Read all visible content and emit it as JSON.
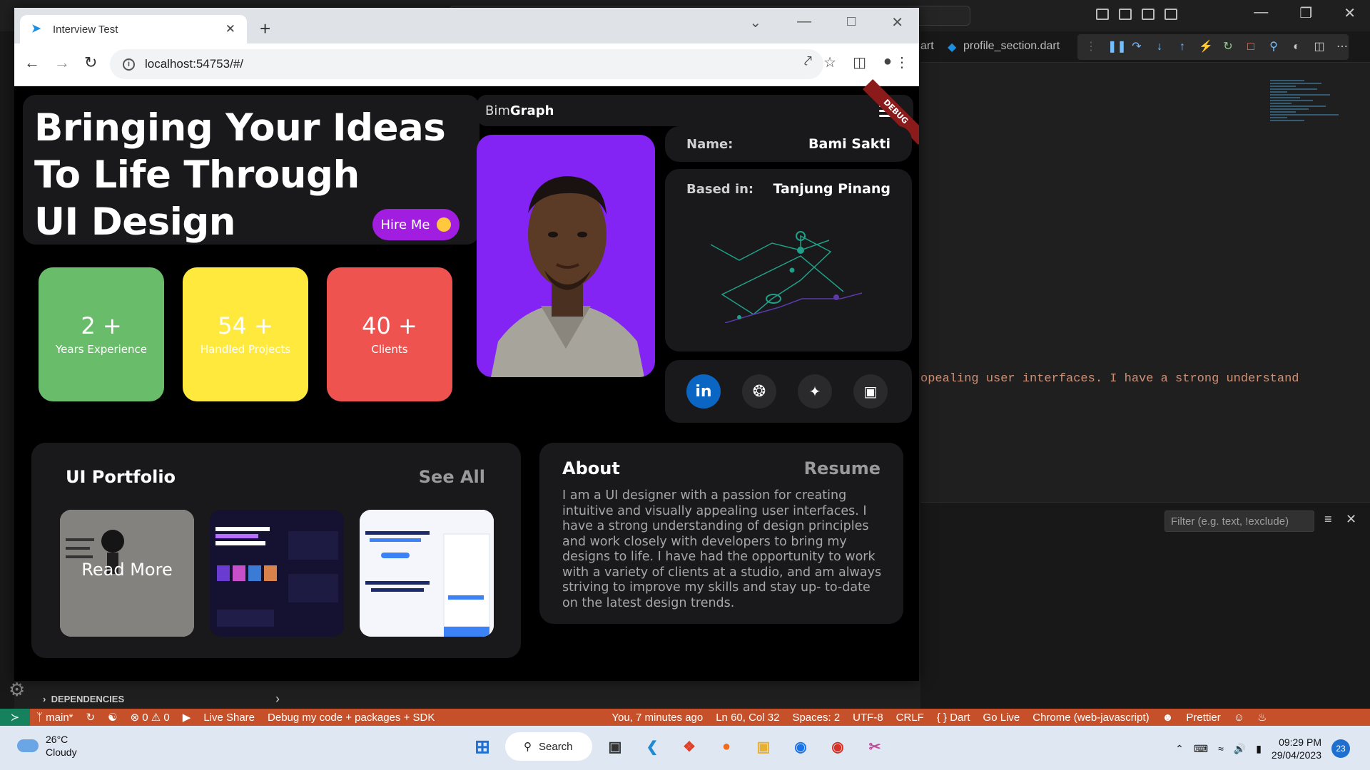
{
  "vscode": {
    "tabs": [
      "art",
      "profile_section.dart"
    ],
    "editor_snippet": "opealing user interfaces. I have a strong understand",
    "filter_placeholder": "Filter (e.g. text, !exclude)",
    "sidebar_section": "DEPENDENCIES",
    "status": {
      "branch": "main*",
      "problems": "⊗ 0 ⚠ 0",
      "live_share": "Live Share",
      "debug_config": "Debug my code + packages + SDK",
      "blame": "You, 7 minutes ago",
      "position": "Ln 60, Col 32",
      "spaces": "Spaces: 2",
      "encoding": "UTF-8",
      "eol": "CRLF",
      "language": "{ } Dart",
      "go_live": "Go Live",
      "device": "Chrome (web-javascript)",
      "prettier": "Prettier"
    }
  },
  "browser": {
    "tab_title": "Interview Test",
    "url": "localhost:54753/#/"
  },
  "app": {
    "hero_line1": "Bringing Your Ideas",
    "hero_line2": "To Life Through",
    "hero_line3": "UI Design",
    "hire_label": "Hire Me",
    "brand_light": "Bim",
    "brand_bold": "Graph",
    "debug_banner": "DEBUG",
    "stats": [
      {
        "value": "2 +",
        "label": "Years Experience",
        "color": "#69bd6a"
      },
      {
        "value": "54 +",
        "label": "Handled Projects",
        "color": "#ffe93d"
      },
      {
        "value": "40 +",
        "label": "Clients",
        "color": "#ef5350"
      }
    ],
    "name_key": "Name:",
    "name_value": "Bami Sakti",
    "based_key": "Based in:",
    "based_value": "Tanjung Pinang",
    "social": [
      "linkedin-icon",
      "dribbble-icon",
      "twitter-icon",
      "instagram-icon"
    ],
    "portfolio_title": "UI Portfolio",
    "see_all": "See All",
    "read_more": "Read More",
    "about_title": "About",
    "resume_label": "Resume",
    "about_text": "I am a UI designer with a passion for creating intuitive and visually appealing user interfaces. I have a strong understanding of design principles and work closely with developers to bring my designs to life. I have had the opportunity to work with a variety of clients at a studio, and am always striving to improve my skills and stay up- to-date on the latest design trends.",
    "accent": "#a11ee0"
  },
  "taskbar": {
    "temp": "26°C",
    "condition": "Cloudy",
    "search": "Search",
    "time": "09:29 PM",
    "date": "29/04/2023",
    "notifications": "23"
  }
}
